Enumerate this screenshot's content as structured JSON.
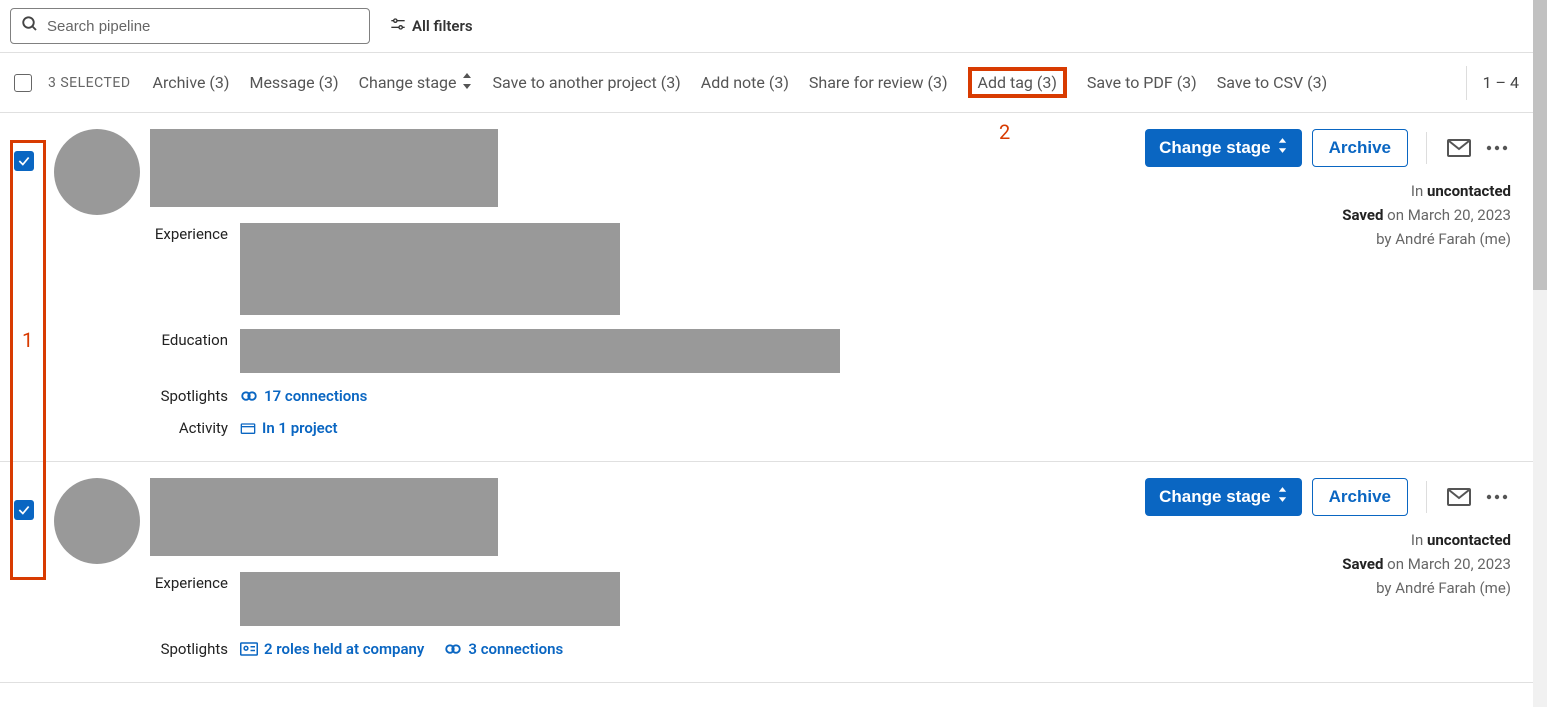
{
  "search": {
    "placeholder": "Search pipeline"
  },
  "filters_label": "All filters",
  "selected_label": "3 SELECTED",
  "actions": {
    "archive": "Archive (3)",
    "message": "Message (3)",
    "change_stage": "Change stage",
    "save_another": "Save to another project (3)",
    "add_note": "Add note (3)",
    "share_review": "Share for review (3)",
    "add_tag": "Add tag (3)",
    "save_pdf": "Save to PDF (3)",
    "save_csv": "Save to CSV (3)"
  },
  "range": "1 – 4",
  "annotations": {
    "num1": "1",
    "num2": "2"
  },
  "cards": [
    {
      "experience_label": "Experience",
      "education_label": "Education",
      "spotlights_label": "Spotlights",
      "activity_label": "Activity",
      "connections": "17 connections",
      "project": "In 1 project",
      "change_stage": "Change stage",
      "archive": "Archive",
      "status_prefix": "In ",
      "status_value": "uncontacted",
      "saved_prefix": "Saved",
      "saved_date": " on March 20, 2023",
      "saved_by": "by André Farah (me)"
    },
    {
      "experience_label": "Experience",
      "spotlights_label": "Spotlights",
      "roles": "2 roles held at company",
      "connections": "3 connections",
      "change_stage": "Change stage",
      "archive": "Archive",
      "status_prefix": "In ",
      "status_value": "uncontacted",
      "saved_prefix": "Saved",
      "saved_date": " on March 20, 2023",
      "saved_by": "by André Farah (me)"
    }
  ]
}
